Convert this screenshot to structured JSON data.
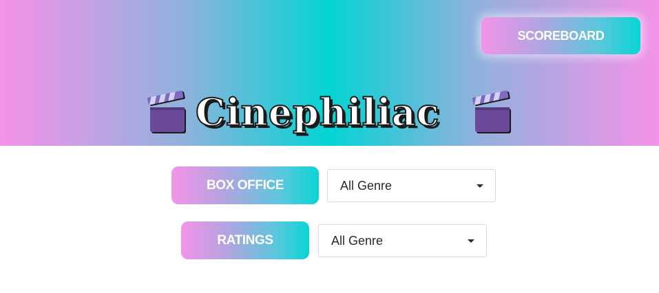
{
  "header": {
    "title": "Cinephiliac",
    "scoreboard_label": "SCOREBOARD",
    "left_icon": "clapperboard-icon",
    "right_icon": "clapperboard-icon"
  },
  "controls": {
    "box_office": {
      "label": "BOX OFFICE",
      "genre_selected": "All Genre"
    },
    "ratings": {
      "label": "RATINGS",
      "genre_selected": "All Genre"
    }
  },
  "colors": {
    "gradient_pink": "#f592e8",
    "gradient_cyan": "#04d4d4",
    "title_fill": "#ffffff",
    "title_shadow": "#1a1a1a",
    "clapper_purple": "#6b4a9a"
  }
}
